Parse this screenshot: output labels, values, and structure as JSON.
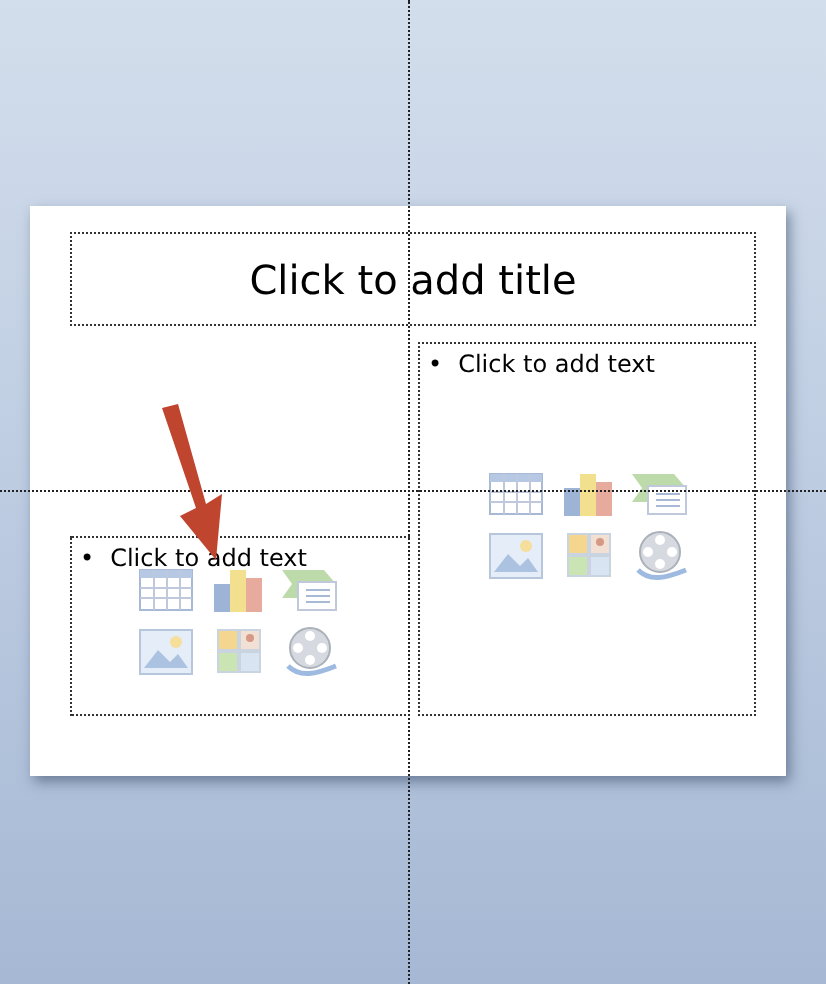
{
  "slide": {
    "title_placeholder": "Click to add title",
    "content_placeholders": [
      {
        "bullet": "•",
        "text": "Click to add text"
      },
      {
        "bullet": "•",
        "text": "Click to add text"
      }
    ]
  }
}
